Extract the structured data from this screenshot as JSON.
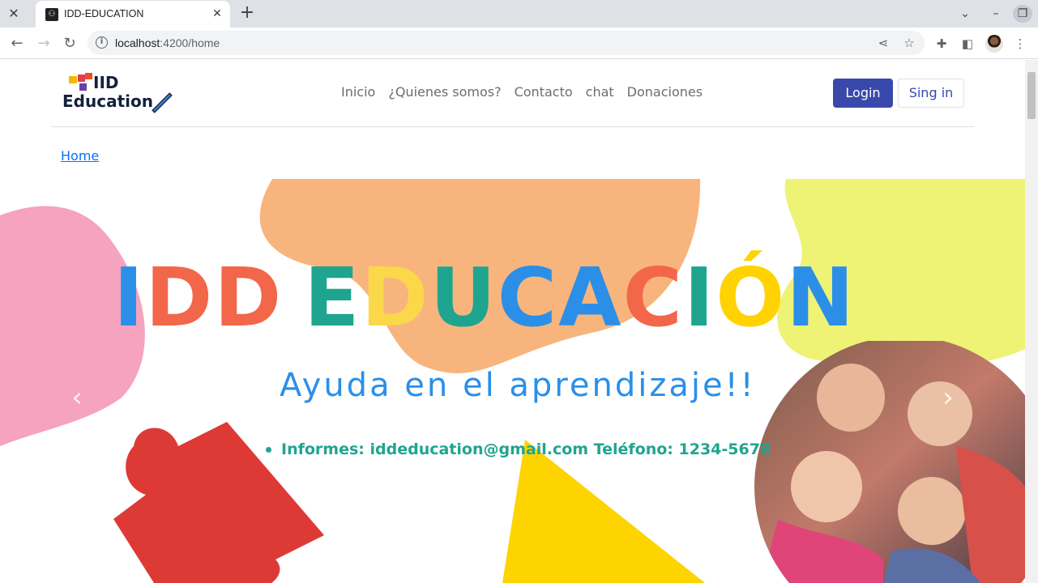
{
  "browser": {
    "tab_title": "IDD-EDUCATION",
    "url_host": "localhost",
    "url_path": ":4200/home"
  },
  "navbar": {
    "logo_line1": "IID",
    "logo_line2": "Education",
    "links": [
      "Inicio",
      "¿Quienes somos?",
      "Contacto",
      "chat",
      "Donaciones"
    ],
    "login_label": "Login",
    "signin_label": "Sing in",
    "login_color": "#3949ab"
  },
  "breadcrumb": "Home",
  "hero": {
    "title_letters": [
      {
        "ch": "I",
        "color": "#2b8fe8"
      },
      {
        "ch": "D",
        "color": "#f26649"
      },
      {
        "ch": "D",
        "color": "#f26649"
      },
      {
        "ch": " ",
        "color": "#000000"
      },
      {
        "ch": "E",
        "color": "#1fa58f"
      },
      {
        "ch": "D",
        "color": "#fad84a"
      },
      {
        "ch": "U",
        "color": "#1fa58f"
      },
      {
        "ch": "C",
        "color": "#2b8fe8"
      },
      {
        "ch": "A",
        "color": "#2b8fe8"
      },
      {
        "ch": "C",
        "color": "#f26649"
      },
      {
        "ch": "I",
        "color": "#1fa58f"
      },
      {
        "ch": "Ó",
        "color": "#ffd200"
      },
      {
        "ch": "N",
        "color": "#2b8fe8"
      }
    ],
    "subtitle": "Ayuda en el aprendizaje!!",
    "info": "Informes: iddeducation@gmail.com  Teléfono: 1234-5678"
  }
}
